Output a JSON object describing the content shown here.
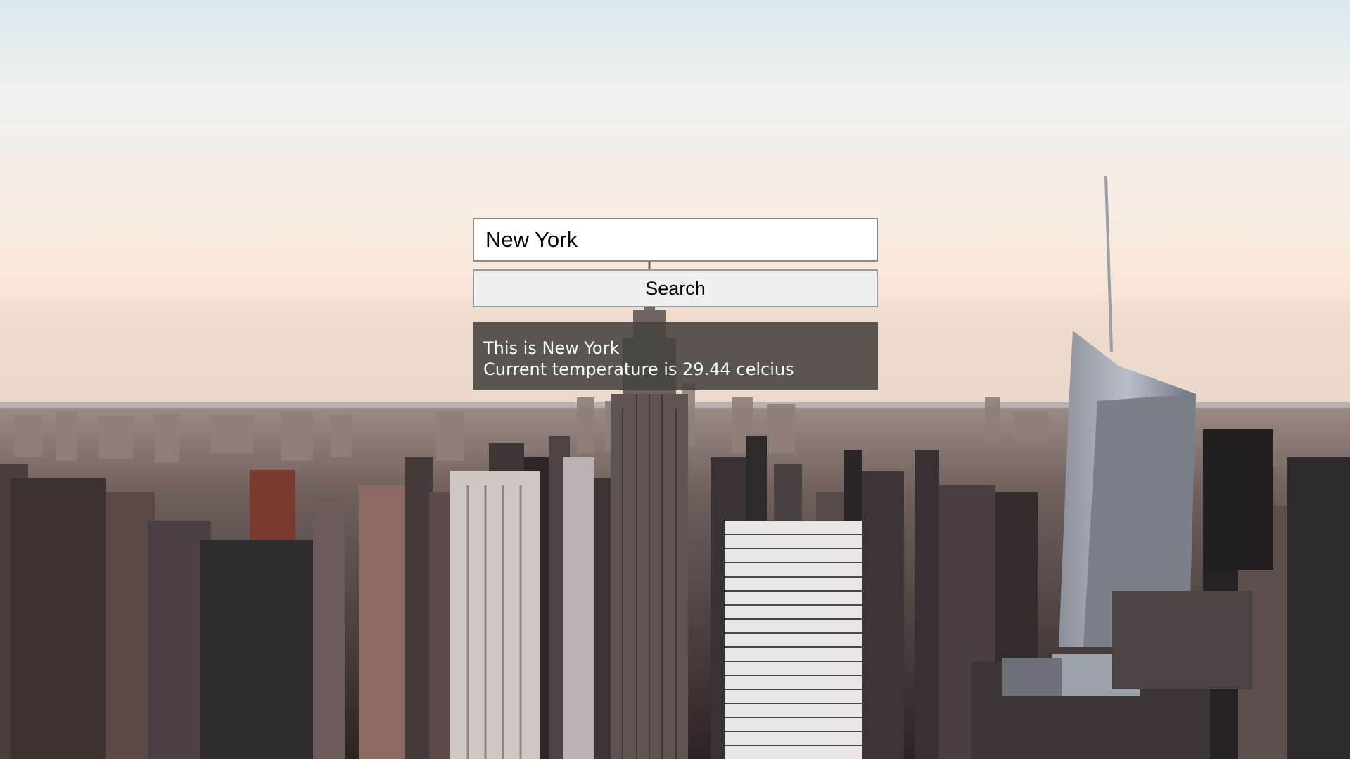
{
  "search": {
    "input_value": "New York",
    "button_label": "Search"
  },
  "result": {
    "line1": "This is New York",
    "line2": "Current temperature is 29.44 celcius"
  }
}
